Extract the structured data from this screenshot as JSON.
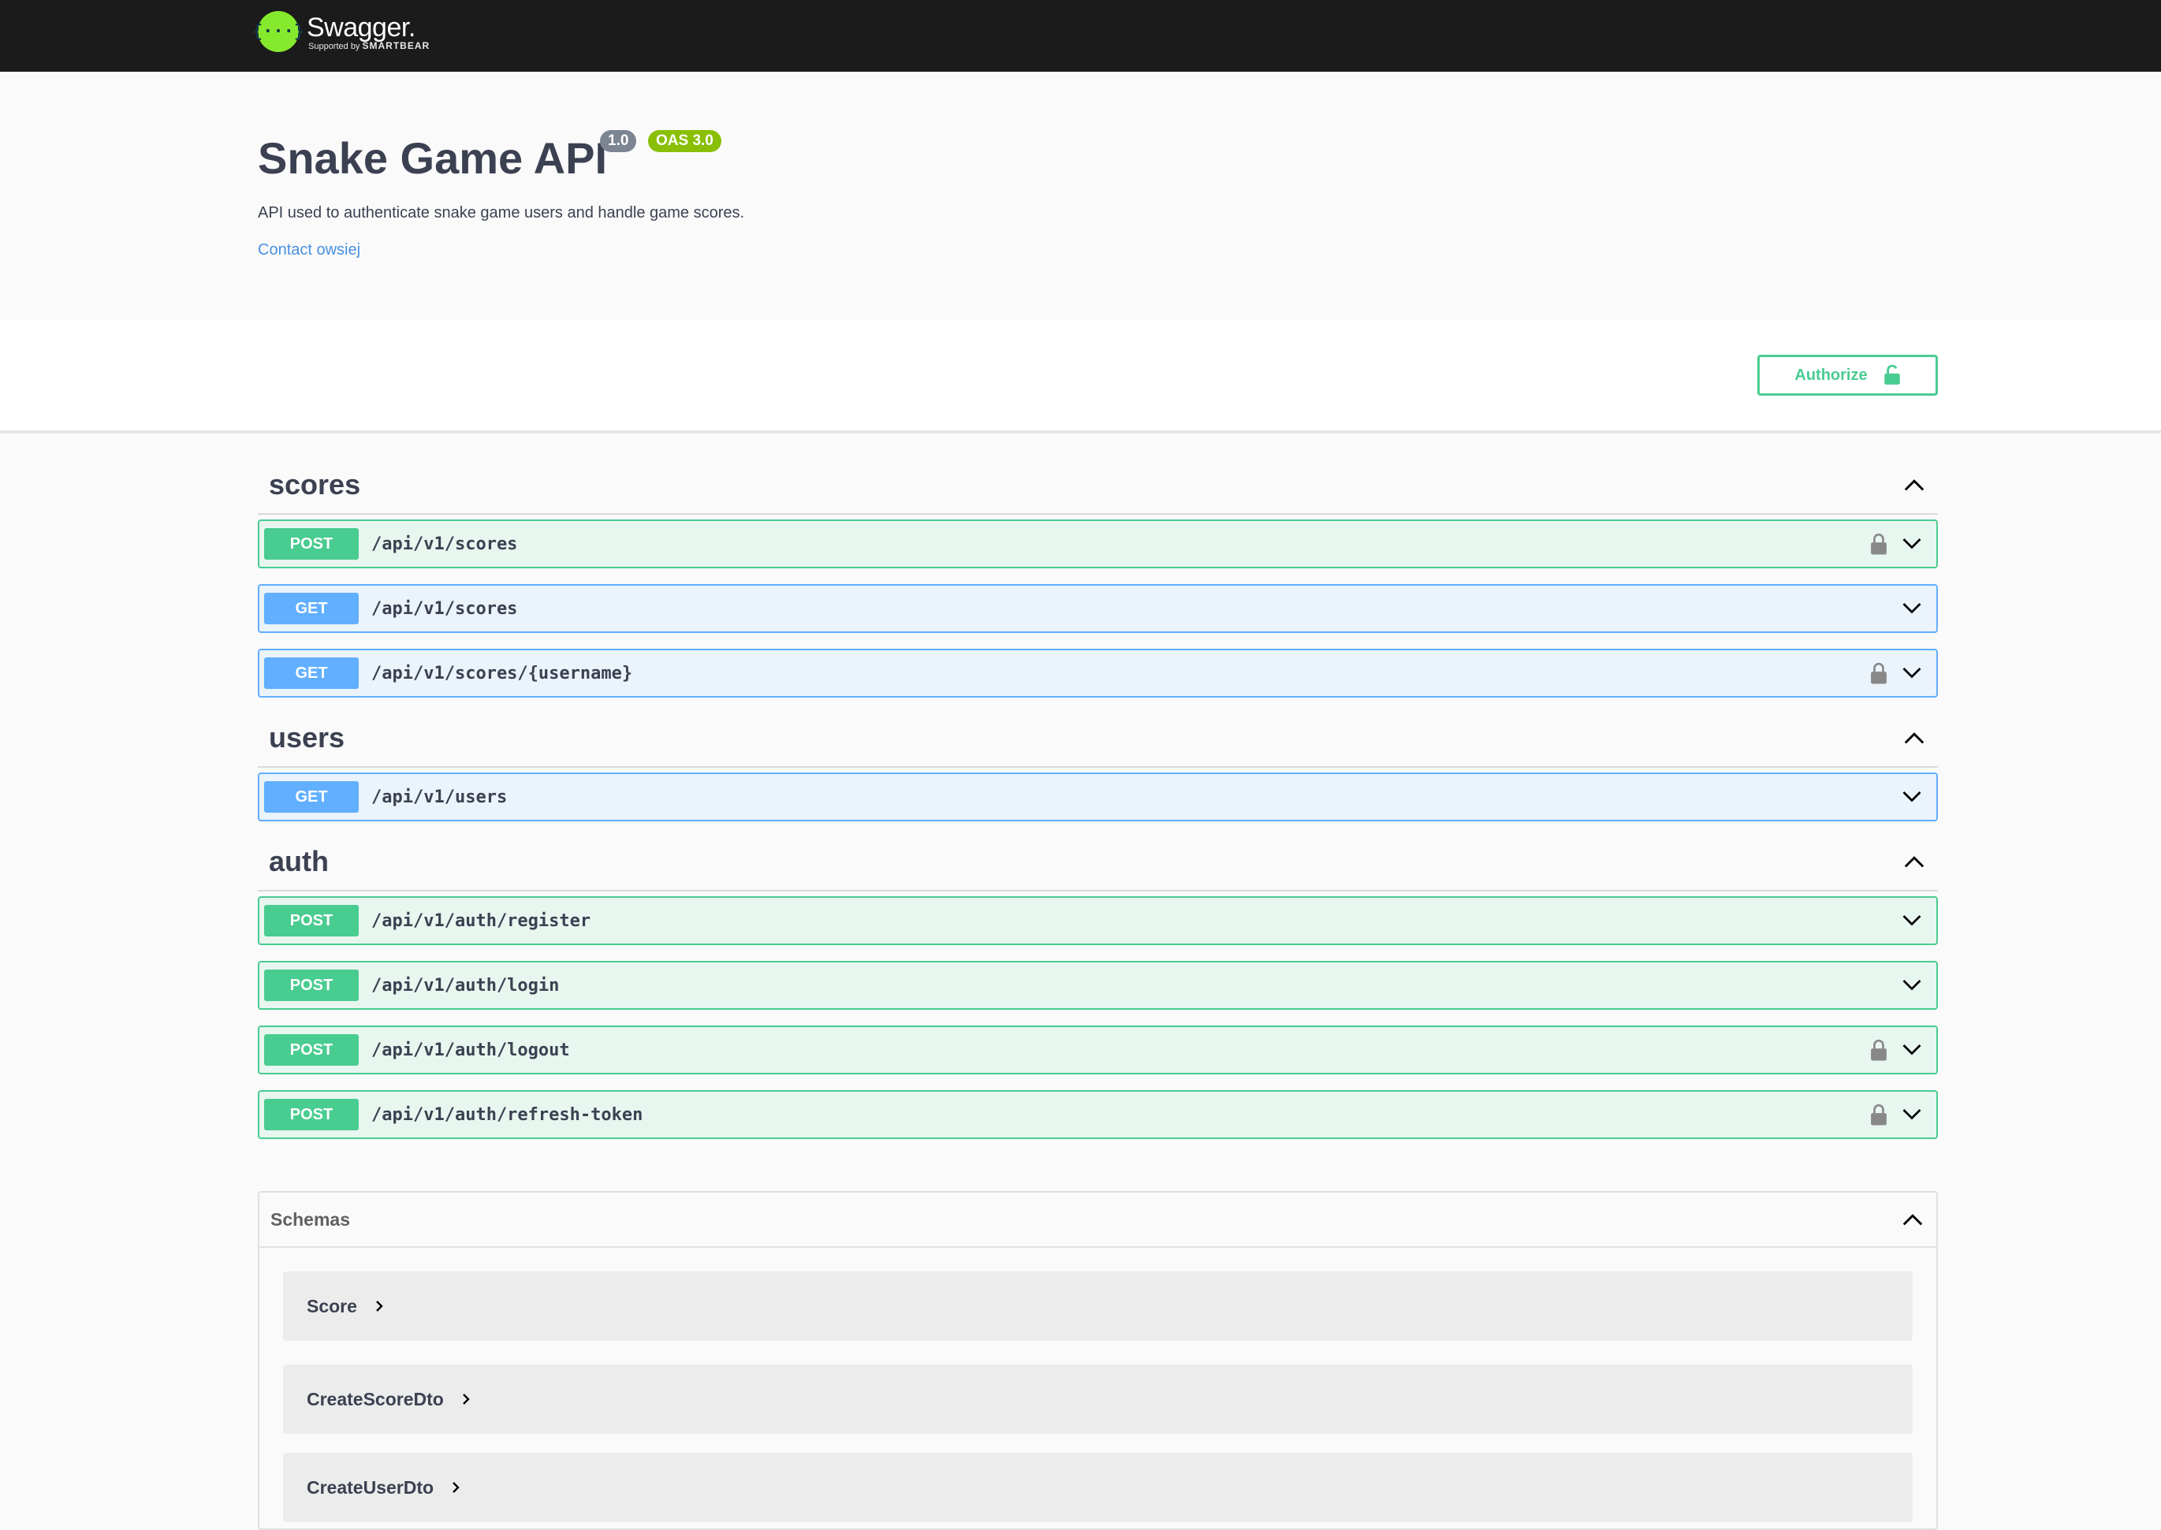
{
  "topbar": {
    "logo_glyph": "{···}",
    "brand": "Swagger.",
    "supported_by": "Supported by",
    "supporter": "SMARTBEAR"
  },
  "info": {
    "title": "Snake Game API",
    "version": "1.0",
    "oas": "OAS 3.0",
    "description": "API used to authenticate snake game users and handle game scores.",
    "contact": "Contact owsiej"
  },
  "auth_button": {
    "label": "Authorize",
    "icon": "unlock-icon"
  },
  "colors": {
    "post": "#49cc90",
    "get": "#61affe",
    "link": "#4990e2",
    "badge_version": "#7d8492",
    "badge_oas": "#89bf04"
  },
  "tags": [
    {
      "name": "scores",
      "ops": [
        {
          "method": "POST",
          "path": "/api/v1/scores",
          "locked": true
        },
        {
          "method": "GET",
          "path": "/api/v1/scores",
          "locked": false
        },
        {
          "method": "GET",
          "path": "/api/v1/scores/{username}",
          "locked": true
        }
      ]
    },
    {
      "name": "users",
      "ops": [
        {
          "method": "GET",
          "path": "/api/v1/users",
          "locked": false
        }
      ]
    },
    {
      "name": "auth",
      "ops": [
        {
          "method": "POST",
          "path": "/api/v1/auth/register",
          "locked": false
        },
        {
          "method": "POST",
          "path": "/api/v1/auth/login",
          "locked": false
        },
        {
          "method": "POST",
          "path": "/api/v1/auth/logout",
          "locked": true
        },
        {
          "method": "POST",
          "path": "/api/v1/auth/refresh-token",
          "locked": true
        }
      ]
    }
  ],
  "schemas": {
    "title": "Schemas",
    "items": [
      "Score",
      "CreateScoreDto",
      "CreateUserDto"
    ]
  }
}
